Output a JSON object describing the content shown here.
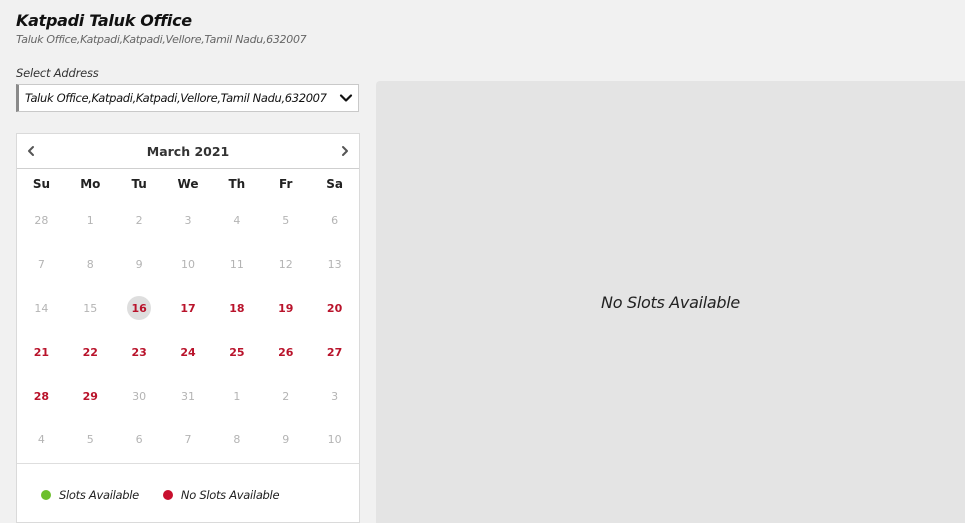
{
  "office": {
    "title": "Katpadi Taluk Office",
    "address": "Taluk Office,Katpadi,Katpadi,Vellore,Tamil Nadu,632007"
  },
  "address_select": {
    "label": "Select Address",
    "selected": "Taluk Office,Katpadi,Katpadi,Vellore,Tamil Nadu,632007"
  },
  "calendar": {
    "month": "March 2021",
    "weekdays": [
      "Su",
      "Mo",
      "Tu",
      "We",
      "Th",
      "Fr",
      "Sa"
    ],
    "weeks": [
      [
        {
          "d": "28",
          "s": "muted"
        },
        {
          "d": "1",
          "s": "muted"
        },
        {
          "d": "2",
          "s": "muted"
        },
        {
          "d": "3",
          "s": "muted"
        },
        {
          "d": "4",
          "s": "muted"
        },
        {
          "d": "5",
          "s": "muted"
        },
        {
          "d": "6",
          "s": "muted"
        }
      ],
      [
        {
          "d": "7",
          "s": "muted"
        },
        {
          "d": "8",
          "s": "muted"
        },
        {
          "d": "9",
          "s": "muted"
        },
        {
          "d": "10",
          "s": "muted"
        },
        {
          "d": "11",
          "s": "muted"
        },
        {
          "d": "12",
          "s": "muted"
        },
        {
          "d": "13",
          "s": "muted"
        }
      ],
      [
        {
          "d": "14",
          "s": "muted"
        },
        {
          "d": "15",
          "s": "muted"
        },
        {
          "d": "16",
          "s": "today"
        },
        {
          "d": "17",
          "s": "no-slots"
        },
        {
          "d": "18",
          "s": "no-slots"
        },
        {
          "d": "19",
          "s": "no-slots"
        },
        {
          "d": "20",
          "s": "no-slots"
        }
      ],
      [
        {
          "d": "21",
          "s": "no-slots"
        },
        {
          "d": "22",
          "s": "no-slots"
        },
        {
          "d": "23",
          "s": "no-slots"
        },
        {
          "d": "24",
          "s": "no-slots"
        },
        {
          "d": "25",
          "s": "no-slots"
        },
        {
          "d": "26",
          "s": "no-slots"
        },
        {
          "d": "27",
          "s": "no-slots"
        }
      ],
      [
        {
          "d": "28",
          "s": "no-slots"
        },
        {
          "d": "29",
          "s": "no-slots"
        },
        {
          "d": "30",
          "s": "muted"
        },
        {
          "d": "31",
          "s": "muted"
        },
        {
          "d": "1",
          "s": "muted"
        },
        {
          "d": "2",
          "s": "muted"
        },
        {
          "d": "3",
          "s": "muted"
        }
      ],
      [
        {
          "d": "4",
          "s": "muted"
        },
        {
          "d": "5",
          "s": "muted"
        },
        {
          "d": "6",
          "s": "muted"
        },
        {
          "d": "7",
          "s": "muted"
        },
        {
          "d": "8",
          "s": "muted"
        },
        {
          "d": "9",
          "s": "muted"
        },
        {
          "d": "10",
          "s": "muted"
        }
      ]
    ]
  },
  "legend": {
    "available": {
      "label": "Slots Available",
      "color": "#6cbf2c"
    },
    "unavailable": {
      "label": "No Slots Available",
      "color": "#c8102e"
    }
  },
  "slots_panel": {
    "message": "No Slots Available"
  },
  "icons": {
    "prev": "chevron-left-icon",
    "next": "chevron-right-icon",
    "select": "chevron-down-icon"
  }
}
